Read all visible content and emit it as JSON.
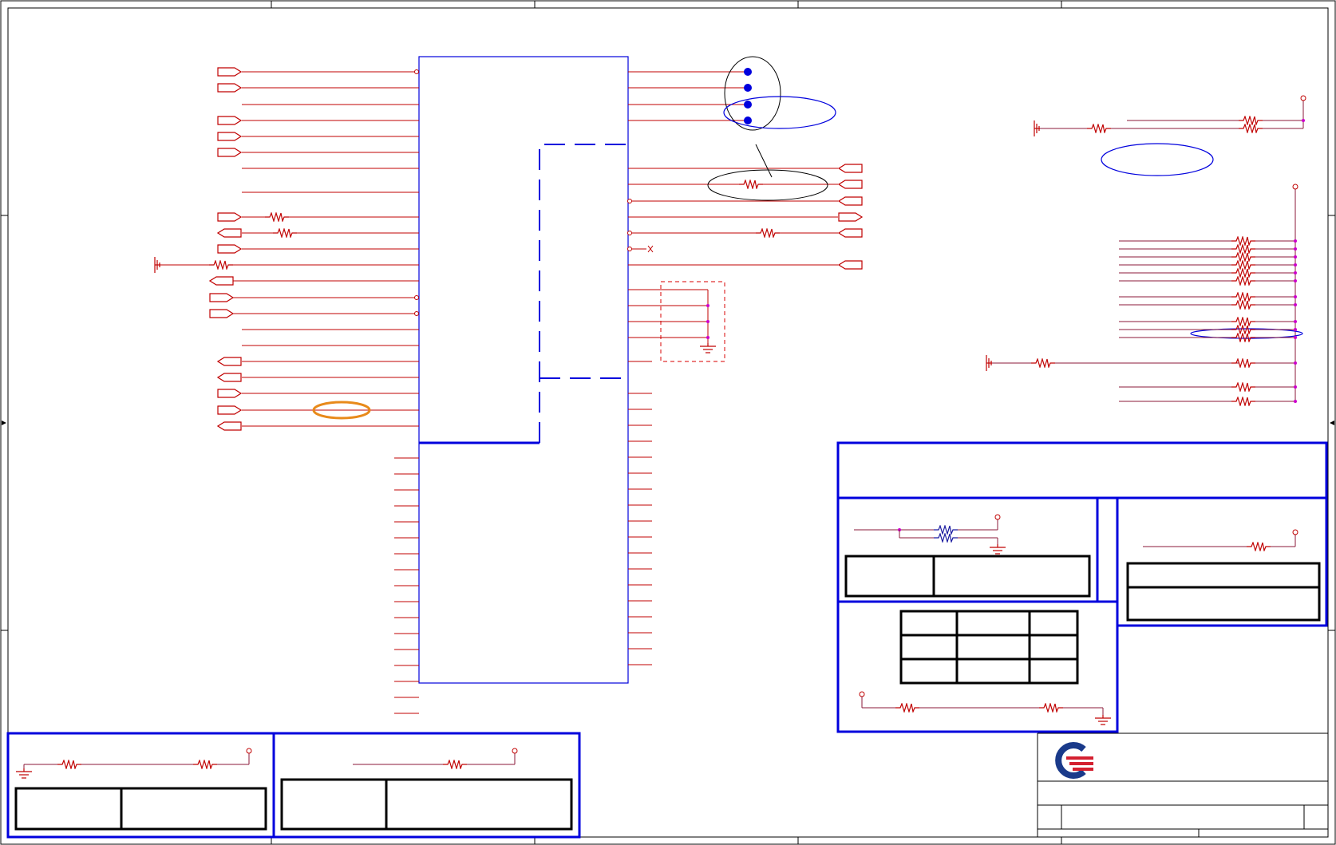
{
  "document": {
    "type": "schematic-sheet",
    "colors": {
      "wire": "#c00000",
      "component": "#0000dd",
      "highlight_orange": "#e88a1a",
      "junction": "#cc00cc",
      "logo_blue": "#1a3a8a",
      "logo_red": "#d42030"
    },
    "icons": [
      "resistor-icon",
      "ground-icon",
      "port-icon",
      "junction-dot-icon",
      "company-logo"
    ]
  }
}
